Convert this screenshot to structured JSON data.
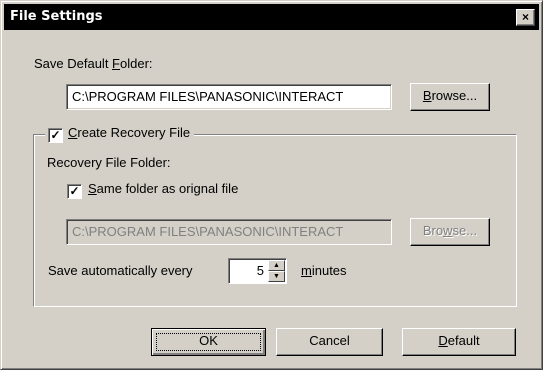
{
  "window": {
    "title": "File Settings",
    "close_glyph": "×"
  },
  "save_default_folder": {
    "label_pre": "Save Default ",
    "label_accel": "F",
    "label_post": "older:",
    "path": "C:\\PROGRAM FILES\\PANASONIC\\INTERACT",
    "browse_accel": "B",
    "browse_rest": "rowse..."
  },
  "recovery": {
    "checkbox_checked": true,
    "label_accel": "C",
    "label_rest": "reate Recovery File",
    "folder_label": "Recovery File Folder:",
    "same_folder_checked": true,
    "same_folder_accel": "S",
    "same_folder_rest": "ame folder as orignal file",
    "path": "C:\\PROGRAM FILES\\PANASONIC\\INTERACT",
    "browse_pre": "Bro",
    "browse_accel": "w",
    "browse_post": "se...",
    "autosave_label": "Save automatically every",
    "autosave_value": "5",
    "minutes_accel": "m",
    "minutes_rest": "inutes"
  },
  "buttons": {
    "ok": "OK",
    "cancel": "Cancel",
    "default_accel": "D",
    "default_rest": "efault"
  },
  "icons": {
    "check": "✓",
    "spin_up": "▲",
    "spin_down": "▼"
  }
}
